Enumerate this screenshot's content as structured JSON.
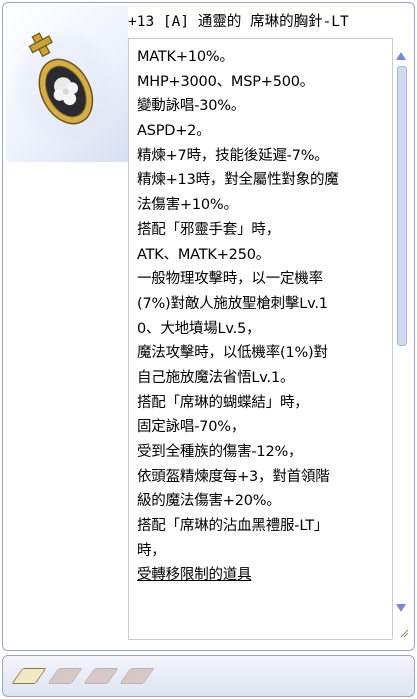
{
  "item": {
    "title": "+13 [A] 通靈的 席琳的胸針-LT",
    "description_lines": [
      "MATK+10%。",
      "MHP+3000、MSP+500。",
      "變動詠唱-30%。",
      "ASPD+2。",
      "精煉+7時，技能後延遲-7%。",
      "精煉+13時，對全屬性對象的魔",
      "法傷害+10%。",
      "搭配「邪靈手套」時，",
      "ATK、MATK+250。",
      "一般物理攻擊時，以一定機率",
      "(7%)對敵人施放聖槍刺擊Lv.1",
      "0、大地墳場Lv.5，",
      "魔法攻擊時，以低機率(1%)對",
      "自己施放魔法省悟Lv.1。",
      "搭配「席琳的蝴蝶結」時，",
      "固定詠唱-70%，",
      "受到全種族的傷害-12%，",
      "依頭盔精煉度每+3，對首領階",
      "級的魔法傷害+20%。",
      "搭配「席琳的沾血黑禮服-LT」",
      "時，"
    ],
    "restriction_link": "受轉移限制的道具",
    "icon": "brooch-icon"
  },
  "card_slots": {
    "icons": [
      "card-slot-icon",
      "empty-slot-icon",
      "empty-slot-icon",
      "empty-slot-icon",
      "empty-slot-icon"
    ]
  },
  "colors": {
    "border": "#9aa6c4",
    "scrollbar_arrow": "#7b87d6",
    "panel_bg": "#eef2fb"
  }
}
